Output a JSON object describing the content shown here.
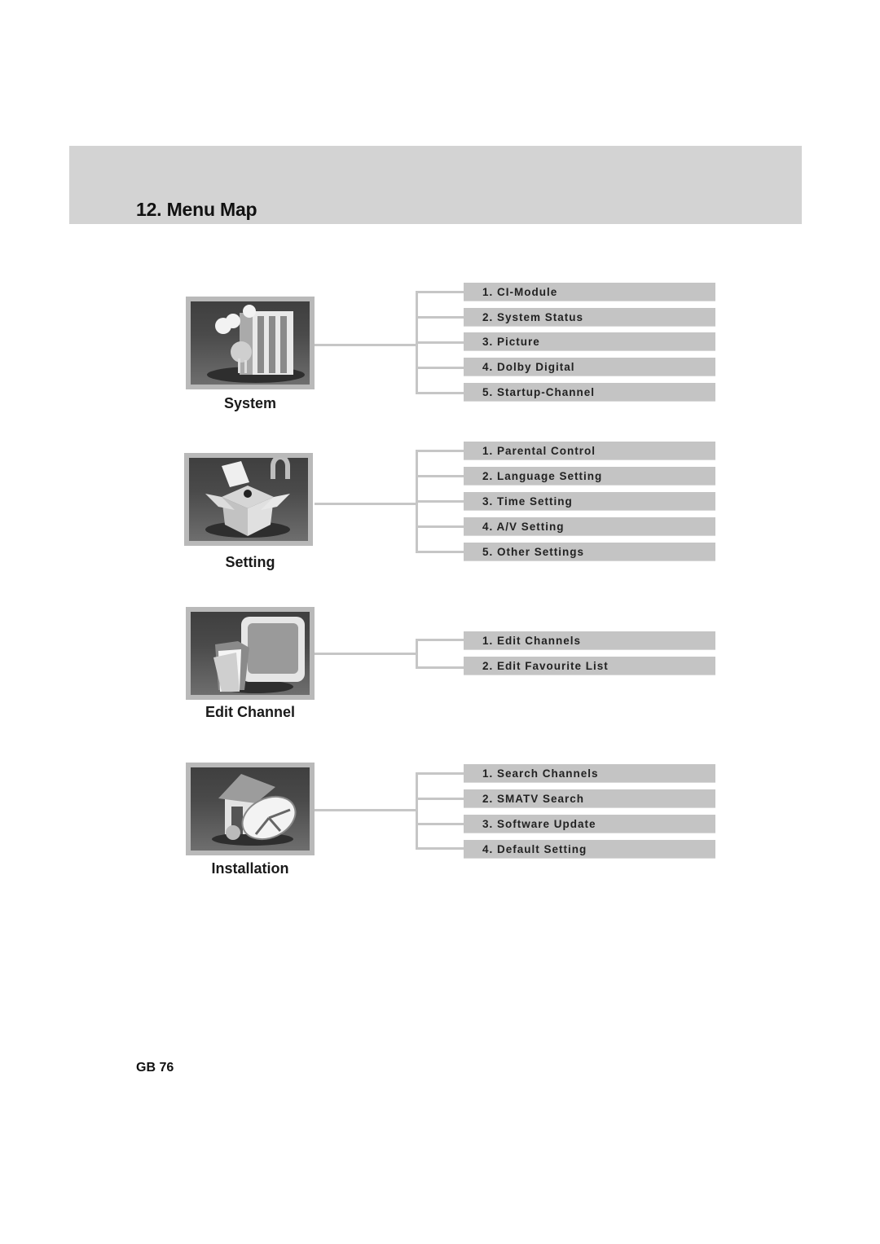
{
  "header": {
    "title": "12. Menu Map"
  },
  "menus": [
    {
      "label": "System",
      "icon": "building-icon",
      "items": [
        "1. CI-Module",
        "2. System Status",
        "3. Picture",
        "4. Dolby Digital",
        "5. Startup-Channel"
      ]
    },
    {
      "label": "Setting",
      "icon": "box-lock-icon",
      "items": [
        "1. Parental Control",
        "2. Language Setting",
        "3. Time Setting",
        "4. A/V Setting",
        "5. Other Settings"
      ]
    },
    {
      "label": "Edit Channel",
      "icon": "tv-folder-icon",
      "items": [
        "1. Edit Channels",
        "2. Edit Favourite List"
      ]
    },
    {
      "label": "Installation",
      "icon": "house-satellite-icon",
      "items": [
        "1. Search Channels",
        "2. SMATV Search",
        "3. Software Update",
        "4. Default Setting"
      ]
    }
  ],
  "footer": {
    "page_label": "GB 76"
  },
  "colors": {
    "band": "#d3d3d3",
    "item_bar": "#c4c4c4",
    "connector": "#c6c6c6"
  }
}
